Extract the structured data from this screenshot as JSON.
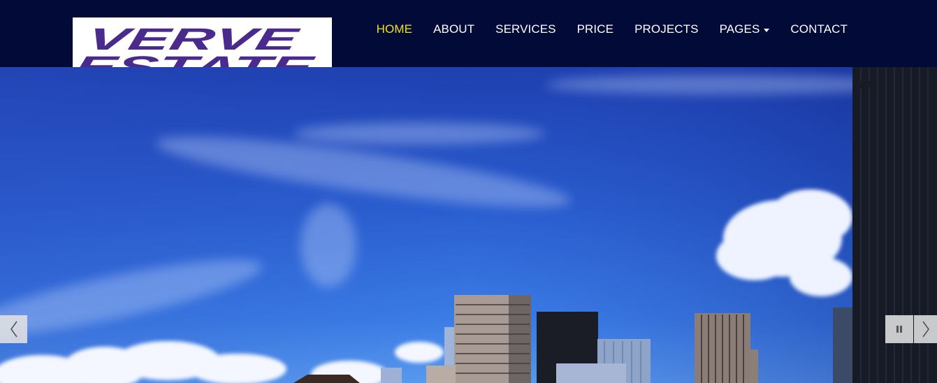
{
  "brand": {
    "logo_line1": "VERVE",
    "logo_line2": "ESTATE",
    "logo_color": "#4a2a8c"
  },
  "nav": {
    "items": [
      {
        "label": "HOME",
        "active": true
      },
      {
        "label": "ABOUT"
      },
      {
        "label": "SERVICES"
      },
      {
        "label": "PRICE"
      },
      {
        "label": "PROJECTS"
      },
      {
        "label": "PAGES",
        "has_dropdown": true
      },
      {
        "label": "CONTACT"
      }
    ],
    "active_color": "#f0e11e",
    "bg_color": "#020a38"
  },
  "slider": {
    "prev_icon": "chevron-left-icon",
    "pause_icon": "pause-icon",
    "next_icon": "chevron-right-icon"
  }
}
